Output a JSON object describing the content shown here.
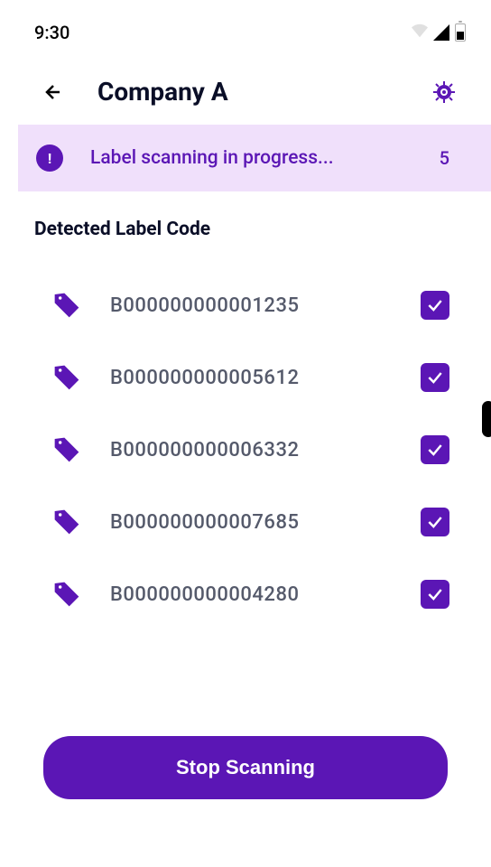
{
  "statusBar": {
    "time": "9:30"
  },
  "header": {
    "title": "Company A"
  },
  "banner": {
    "infoSymbol": "!",
    "text": "Label scanning in progress...",
    "count": "5"
  },
  "section": {
    "title": "Detected Label Code"
  },
  "labels": [
    {
      "code": "B000000000001235",
      "checked": true
    },
    {
      "code": "B000000000005612",
      "checked": true
    },
    {
      "code": "B000000000006332",
      "checked": true
    },
    {
      "code": "B000000000007685",
      "checked": true
    },
    {
      "code": "B000000000004280",
      "checked": true
    }
  ],
  "button": {
    "stop": "Stop Scanning"
  }
}
